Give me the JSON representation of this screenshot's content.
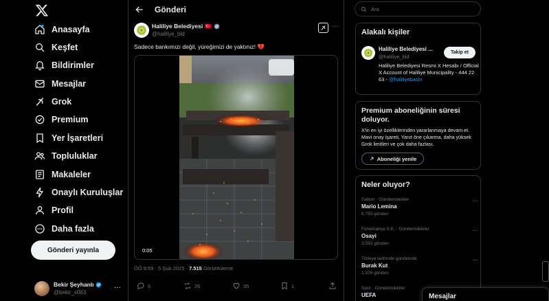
{
  "app": {
    "accent": "#1d9bf0",
    "background": "#000000"
  },
  "nav": {
    "logo_icon": "x-logo",
    "items": [
      {
        "label": "Anasayfa",
        "icon": "home-icon"
      },
      {
        "label": "Keşfet",
        "icon": "search-icon"
      },
      {
        "label": "Bildirimler",
        "icon": "bell-icon"
      },
      {
        "label": "Mesajlar",
        "icon": "mail-icon"
      },
      {
        "label": "Grok",
        "icon": "grok-icon"
      },
      {
        "label": "Premium",
        "icon": "premium-icon"
      },
      {
        "label": "Yer İşaretleri",
        "icon": "bookmark-icon"
      },
      {
        "label": "Topluluklar",
        "icon": "communities-icon"
      },
      {
        "label": "Makaleler",
        "icon": "articles-icon"
      },
      {
        "label": "Onaylı Kuruluşlar",
        "icon": "lightning-icon"
      },
      {
        "label": "Profil",
        "icon": "profile-icon"
      },
      {
        "label": "Daha fazla",
        "icon": "more-circle-icon"
      }
    ],
    "post_button": "Gönderi yayınla",
    "account": {
      "name": "Bekir Şeyhanlı",
      "handle": "@bekir_s063",
      "more": "···"
    }
  },
  "header": {
    "title": "Gönderi"
  },
  "tweet": {
    "author_name": "Haliliye Belediyesi",
    "flag": "🇹🇷",
    "author_handle": "@haliliye_bld",
    "text": "Sadece bankımızı değil, yüreğimizi de yaktınız! 💔",
    "video_time": "0:05",
    "time": "ÖÖ 9:59 · 5 Şub 2025 ·",
    "views": "7.515",
    "views_label": "Görüntüleme",
    "more": "···",
    "actions": {
      "replies": "6",
      "reposts": "26",
      "likes": "35",
      "bookmarks": "1"
    }
  },
  "search": {
    "placeholder": "Ara"
  },
  "related": {
    "title": "Alakalı kişiler",
    "name": "Haliliye Belediyesi ...",
    "handle": "@haliliye_bld",
    "follow": "Takip et",
    "bio": "Haliliye Belediyesi Resmi X Hesabı / Official X Account of Haliliye Municipality - 444 22 63 -",
    "bio_link": "@haliliyebasin"
  },
  "premium": {
    "title": "Premium aboneliğinin süresi doluyor.",
    "text": "X'in en iyi özelliklerinden yararlanmaya devam et. Mavi onay işareti, Yanıt öne çıkarma, daha yüksek Grok limitleri ve çok daha fazlası.",
    "button": "Aboneliği yenile"
  },
  "trends": {
    "title": "Neler oluyor?",
    "items": [
      {
        "context": "Gabon · Gündemdekiler",
        "name": "Mario Lemina",
        "count": "6.753 gönderi"
      },
      {
        "context": "Fenerbahçe S.K. · Gündemdekiler",
        "name": "Osayi",
        "count": "3.593 gönderi"
      },
      {
        "context": "Türkiye tarihinde gündemde",
        "name": "Burak Kut",
        "count": "1.376 gönderi"
      },
      {
        "context": "Spor · Gündemdekiler",
        "name": "UEFA",
        "count": ""
      }
    ]
  },
  "messages": {
    "title": "Mesajlar"
  }
}
